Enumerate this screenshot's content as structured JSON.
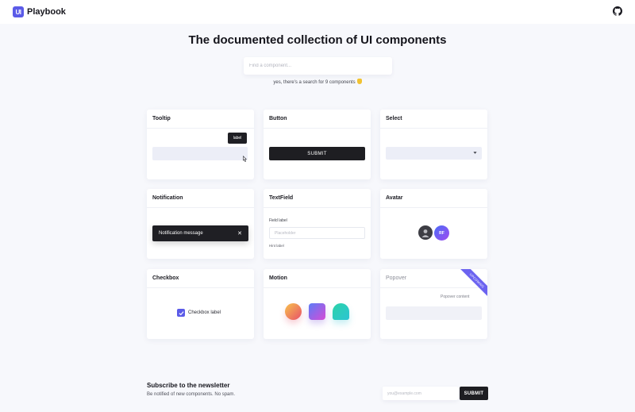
{
  "header": {
    "logo_mark": "UI",
    "logo_text": "Playbook",
    "github_icon": "github-icon"
  },
  "hero": {
    "title": "The documented collection of UI components",
    "search_placeholder": "Find a component...",
    "search_hint": "yes, there's a search for 9 components"
  },
  "cards": {
    "tooltip": {
      "title": "Tooltip",
      "bubble": "label"
    },
    "button": {
      "title": "Button",
      "submit": "SUBMIT"
    },
    "select": {
      "title": "Select"
    },
    "notification": {
      "title": "Notification",
      "message": "Notification message",
      "close": "✕"
    },
    "textfield": {
      "title": "TextField",
      "label": "Field label",
      "placeholder": "Placeholder",
      "hint": "Hint label"
    },
    "avatar": {
      "title": "Avatar",
      "initials": "RF"
    },
    "checkbox": {
      "title": "Checkbox",
      "label": "Checkbox label",
      "checked": true
    },
    "motion": {
      "title": "Motion"
    },
    "popover": {
      "title": "Popover",
      "content": "Popover content",
      "ribbon": "UPCOMING"
    }
  },
  "newsletter": {
    "title": "Subscribe to the newsletter",
    "subtitle": "Be notified of new components. No spam.",
    "email_placeholder": "you@example.com",
    "submit": "SUBMIT"
  },
  "colors": {
    "accent": "#5b5be8",
    "dark": "#1e1e22",
    "background": "#f7f8fc"
  }
}
